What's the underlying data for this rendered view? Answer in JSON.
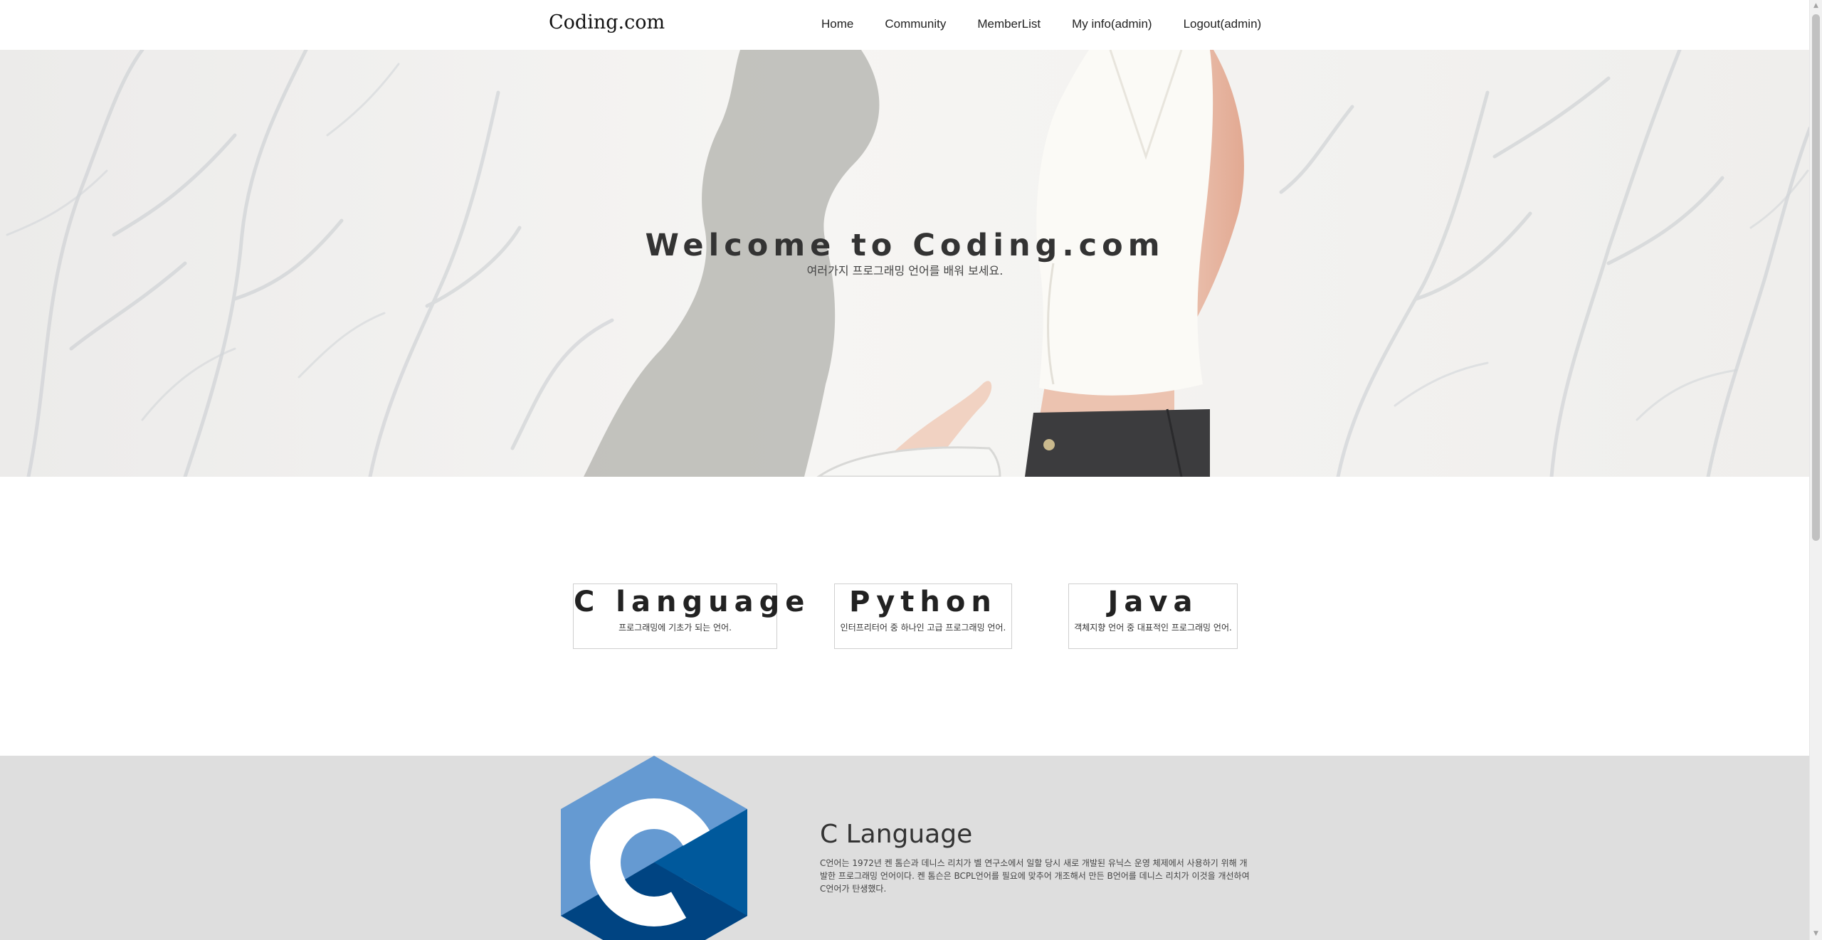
{
  "brand": "Coding.com",
  "nav": [
    "Home",
    "Community",
    "MemberList",
    "My info(admin)",
    "Logout(admin)"
  ],
  "hero": {
    "title": "Welcome to Coding.com",
    "subtitle": "여러가지 프로그래밍 언어를 배워 보세요."
  },
  "cards": [
    {
      "title": "C language",
      "desc": "프로그래밍에 기초가 되는 언어."
    },
    {
      "title": "Python",
      "desc": "인터프리터어 중 하나인 고급 프로그래밍 언어."
    },
    {
      "title": "Java",
      "desc": "객체지향 언어 중 대표적인 프로그래밍 언어."
    }
  ],
  "feature": {
    "title": "C Language",
    "text": "C언어는 1972년 켄 톰슨과 데니스 리치가 벨 연구소에서 일할 당시 새로 개발된 유닉스 운영 체제에서 사용하기 위해 개발한 프로그래밍 언어이다. 켄 톰슨은 BCPL언어를 필요에 맞추어 개조해서 만든 B언어를 데니스 리치가 이것을 개선하여 C언어가 탄생했다.",
    "logo_colors": {
      "light": "#659ad2",
      "mid": "#00599c",
      "dark": "#004482"
    }
  },
  "colors": {
    "feature_bg": "#dedede",
    "hero_bg": "#f4f3f1"
  }
}
